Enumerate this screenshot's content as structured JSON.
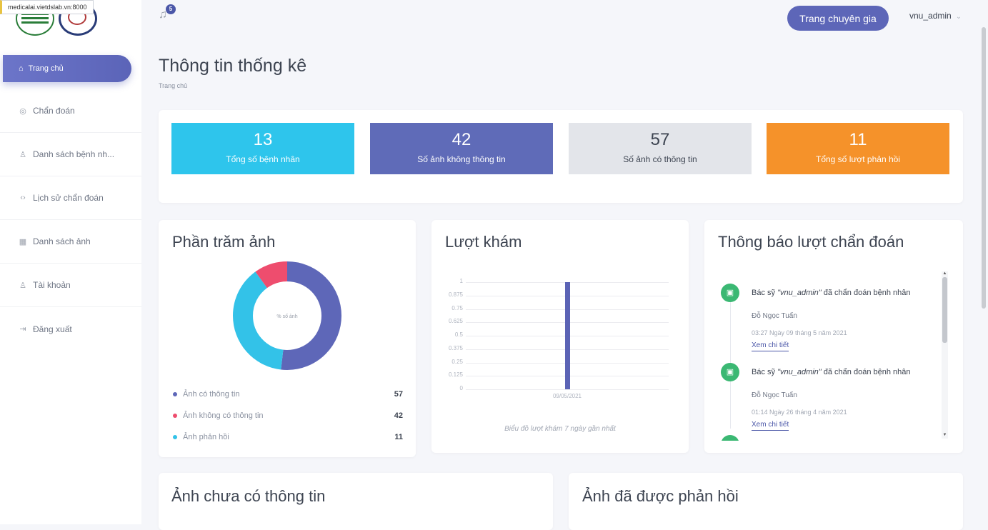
{
  "browser": {
    "url_tooltip": "medicalai.vietdslab.vn:8000"
  },
  "sidebar": {
    "active": {
      "label": "Trang chủ",
      "icon": "home-icon"
    },
    "items": [
      {
        "label": "Chẩn đoán",
        "icon": "target-icon"
      },
      {
        "label": "Danh sách bệnh nh...",
        "icon": "users-icon"
      },
      {
        "label": "Lịch sử chẩn đoán",
        "icon": "code-icon"
      },
      {
        "label": "Danh sách ảnh",
        "icon": "grid-icon"
      },
      {
        "label": "Tài khoản",
        "icon": "user-icon"
      },
      {
        "label": "Đăng xuất",
        "icon": "logout-icon"
      }
    ]
  },
  "header": {
    "notification_count": "5",
    "expert_button": "Trang chuyên gia",
    "username": "vnu_admin"
  },
  "page": {
    "title": "Thông tin thống kê",
    "breadcrumb": "Trang chủ"
  },
  "stats": [
    {
      "value": "13",
      "label": "Tổng số bệnh nhân",
      "color": "#2ec5ec"
    },
    {
      "value": "42",
      "label": "Số ảnh không thông tin",
      "color": "#5f6bb8"
    },
    {
      "value": "57",
      "label": "Số ảnh có thông tin",
      "color": "#e3e5ea"
    },
    {
      "value": "11",
      "label": "Tổng số lượt phản hồi",
      "color": "#f5922a"
    }
  ],
  "percent_card": {
    "title": "Phần trăm ảnh",
    "center_label": "% số ảnh",
    "legend": [
      {
        "label": "Ảnh có thông tin",
        "value": "57",
        "color": "#5e67b8"
      },
      {
        "label": "Ảnh không có thông tin",
        "value": "42",
        "color": "#ee4d6e"
      },
      {
        "label": "Ảnh phản hồi",
        "value": "11",
        "color": "#33c2e8"
      }
    ]
  },
  "visits_card": {
    "title": "Lượt khám",
    "caption": "Biểu đồ lượt khám 7 ngày gần nhất"
  },
  "notifications_card": {
    "title": "Thông báo lượt chẩn đoán",
    "items": [
      {
        "prefix": "Bác sỹ ",
        "doctor": "\"vnu_admin\"",
        "suffix": " đã chẩn đoán bệnh nhân",
        "patient": "Đỗ Ngọc Tuấn",
        "time": "03:27 Ngày 09 tháng 5 năm 2021",
        "link": "Xem chi tiết"
      },
      {
        "prefix": "Bác sỹ ",
        "doctor": "\"vnu_admin\"",
        "suffix": " đã chẩn đoán bệnh nhân",
        "patient": "Đỗ Ngọc Tuấn",
        "time": "01:14 Ngày 26 tháng 4 năm 2021",
        "link": "Xem chi tiết"
      }
    ]
  },
  "bottom_cards": {
    "left_title": "Ảnh chưa có thông tin",
    "right_title": "Ảnh đã được phản hồi"
  },
  "chart_data": [
    {
      "type": "pie",
      "title": "",
      "categories": [
        "Ảnh có thông tin",
        "Ảnh không có thông tin",
        "Ảnh phản hồi"
      ],
      "values": [
        57,
        42,
        11
      ],
      "colors": [
        "#5e67b8",
        "#33c2e8",
        "#ee4d6e"
      ],
      "center_label": "% số ảnh"
    },
    {
      "type": "bar",
      "title": "",
      "categories": [
        "09/05/2021"
      ],
      "values": [
        1
      ],
      "yticks": [
        "1",
        "0.875",
        "0.75",
        "0.625",
        "0.5",
        "0.375",
        "0.25",
        "0.125",
        "0"
      ],
      "ylim": [
        0,
        1
      ],
      "grid": true,
      "color": "#5b63b5",
      "caption": "Biểu đồ lượt khám 7 ngày gần nhất"
    }
  ]
}
